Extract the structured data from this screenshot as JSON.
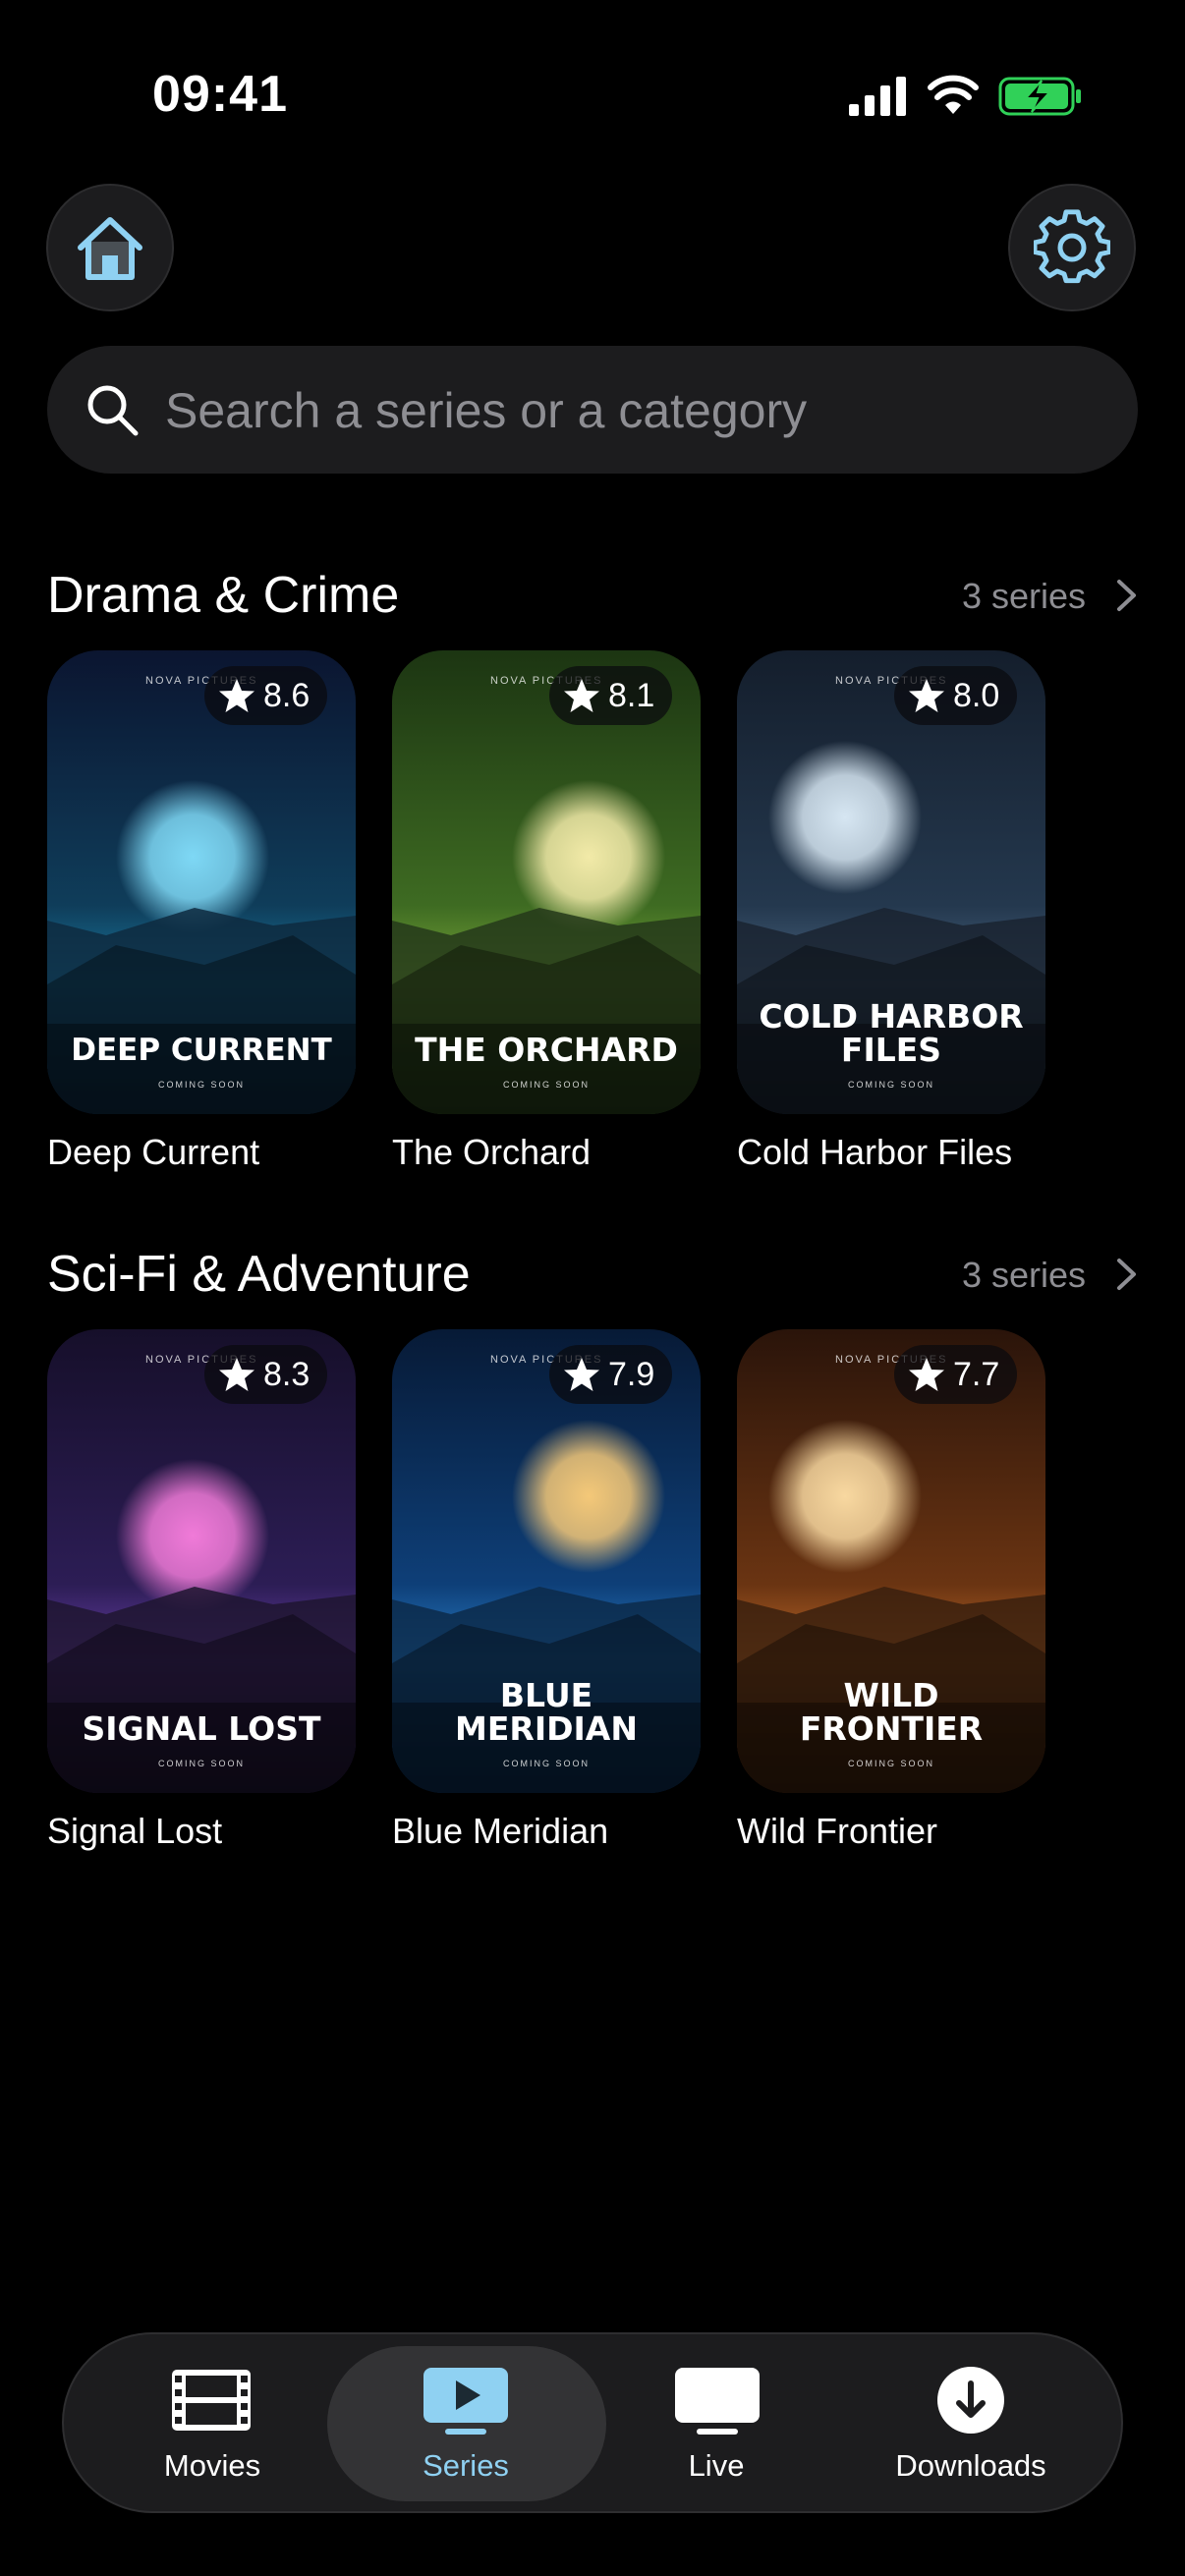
{
  "status_bar": {
    "time": "09:41"
  },
  "header": {
    "home_icon": "home-icon",
    "settings_icon": "gear-icon",
    "accent_color": "#8fd1f2"
  },
  "search": {
    "placeholder": "Search a series or a category"
  },
  "sections": [
    {
      "title": "Drama & Crime",
      "count": "3 series",
      "items": [
        {
          "label": "Deep Current",
          "rating": "8.6",
          "poster_line1": "DEEP CURRENT",
          "poster_line2": "",
          "studio": "NOVA PICTURES",
          "tagline": "COMING SOON",
          "colors": [
            "#0b1530",
            "#0f3d5a",
            "#1a7aa0"
          ],
          "sun": "#7ed8f5",
          "mountain": "#0e2a3f"
        },
        {
          "label": "The Orchard",
          "rating": "8.1",
          "poster_line1": "THE ORCHARD",
          "poster_line2": "",
          "studio": "NOVA PICTURES",
          "tagline": "COMING SOON",
          "colors": [
            "#1c3512",
            "#3e6b22",
            "#7aa83a"
          ],
          "sun": "#f2eaa8",
          "mountain": "#24381a"
        },
        {
          "label": "Cold Harbor Files",
          "rating": "8.0",
          "poster_line1": "COLD HARBOR",
          "poster_line2": "FILES",
          "studio": "NOVA PICTURES",
          "tagline": "COMING SOON",
          "colors": [
            "#141e2c",
            "#24384e",
            "#4a6580"
          ],
          "sun": "#d6e6f2",
          "mountain": "#1a2330"
        }
      ]
    },
    {
      "title": "Sci-Fi & Adventure",
      "count": "3 series",
      "items": [
        {
          "label": "Signal Lost",
          "rating": "8.3",
          "poster_line1": "SIGNAL LOST",
          "poster_line2": "",
          "studio": "NOVA PICTURES",
          "tagline": "COMING SOON",
          "colors": [
            "#160f2a",
            "#2c1d55",
            "#6a3fa8"
          ],
          "sun": "#f07ad8",
          "mountain": "#1e1530"
        },
        {
          "label": "Blue Meridian",
          "rating": "7.9",
          "poster_line1": "BLUE",
          "poster_line2": "MERIDIAN",
          "studio": "NOVA PICTURES",
          "tagline": "COMING SOON",
          "colors": [
            "#071a36",
            "#0e3f78",
            "#2a7fc8"
          ],
          "sun": "#f4c878",
          "mountain": "#0c2a4a"
        },
        {
          "label": "Wild Frontier",
          "rating": "7.7",
          "poster_line1": "WILD",
          "poster_line2": "FRONTIER",
          "studio": "NOVA PICTURES",
          "tagline": "COMING SOON",
          "colors": [
            "#2a140a",
            "#6a3412",
            "#c06a2a"
          ],
          "sun": "#f8d8a0",
          "mountain": "#3a200e"
        }
      ]
    }
  ],
  "tabbar": {
    "tabs": [
      {
        "label": "Movies",
        "icon": "film-icon",
        "active": false
      },
      {
        "label": "Series",
        "icon": "play-tv-icon",
        "active": true
      },
      {
        "label": "Live",
        "icon": "tv-icon",
        "active": false
      },
      {
        "label": "Downloads",
        "icon": "download-icon",
        "active": false
      }
    ]
  }
}
